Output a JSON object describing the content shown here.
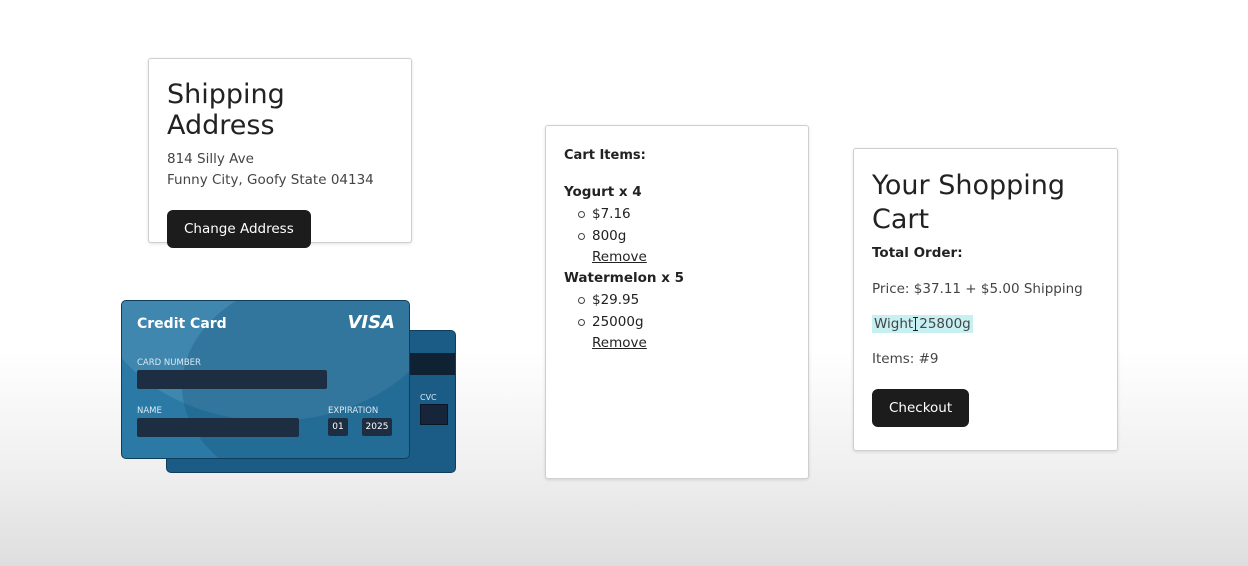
{
  "shipping": {
    "title": "Shipping Address",
    "address_line1": "814 Silly Ave",
    "address_line2": "Funny City, Goofy State 04134",
    "change_button": "Change Address"
  },
  "card": {
    "title": "Credit Card",
    "brand": "VISA",
    "card_number_label": "CARD NUMBER",
    "name_label": "NAME",
    "expiration_label": "EXPIRATION",
    "exp_month": "01",
    "exp_year": "2025",
    "cvc_label": "CVC",
    "colors": {
      "front": "#2a7aa5",
      "back": "#1a5c85",
      "fields": "#1e2e42"
    }
  },
  "cart_items": {
    "header": "Cart Items:",
    "items": [
      {
        "name": "Yogurt x 4",
        "price": "$7.16",
        "weight": "800g",
        "remove": "Remove"
      },
      {
        "name": "Watermelon x 5",
        "price": "$29.95",
        "weight": "25000g",
        "remove": "Remove"
      }
    ]
  },
  "summary": {
    "title": "Your Shopping Cart",
    "total_label": "Total Order:",
    "price": "Price: $37.11 + $5.00 Shipping",
    "weight_prefix": "Wight",
    "weight_value": "25800g",
    "items": "Items: #9",
    "checkout_button": "Checkout",
    "highlight_color": "#c7f0f3"
  }
}
